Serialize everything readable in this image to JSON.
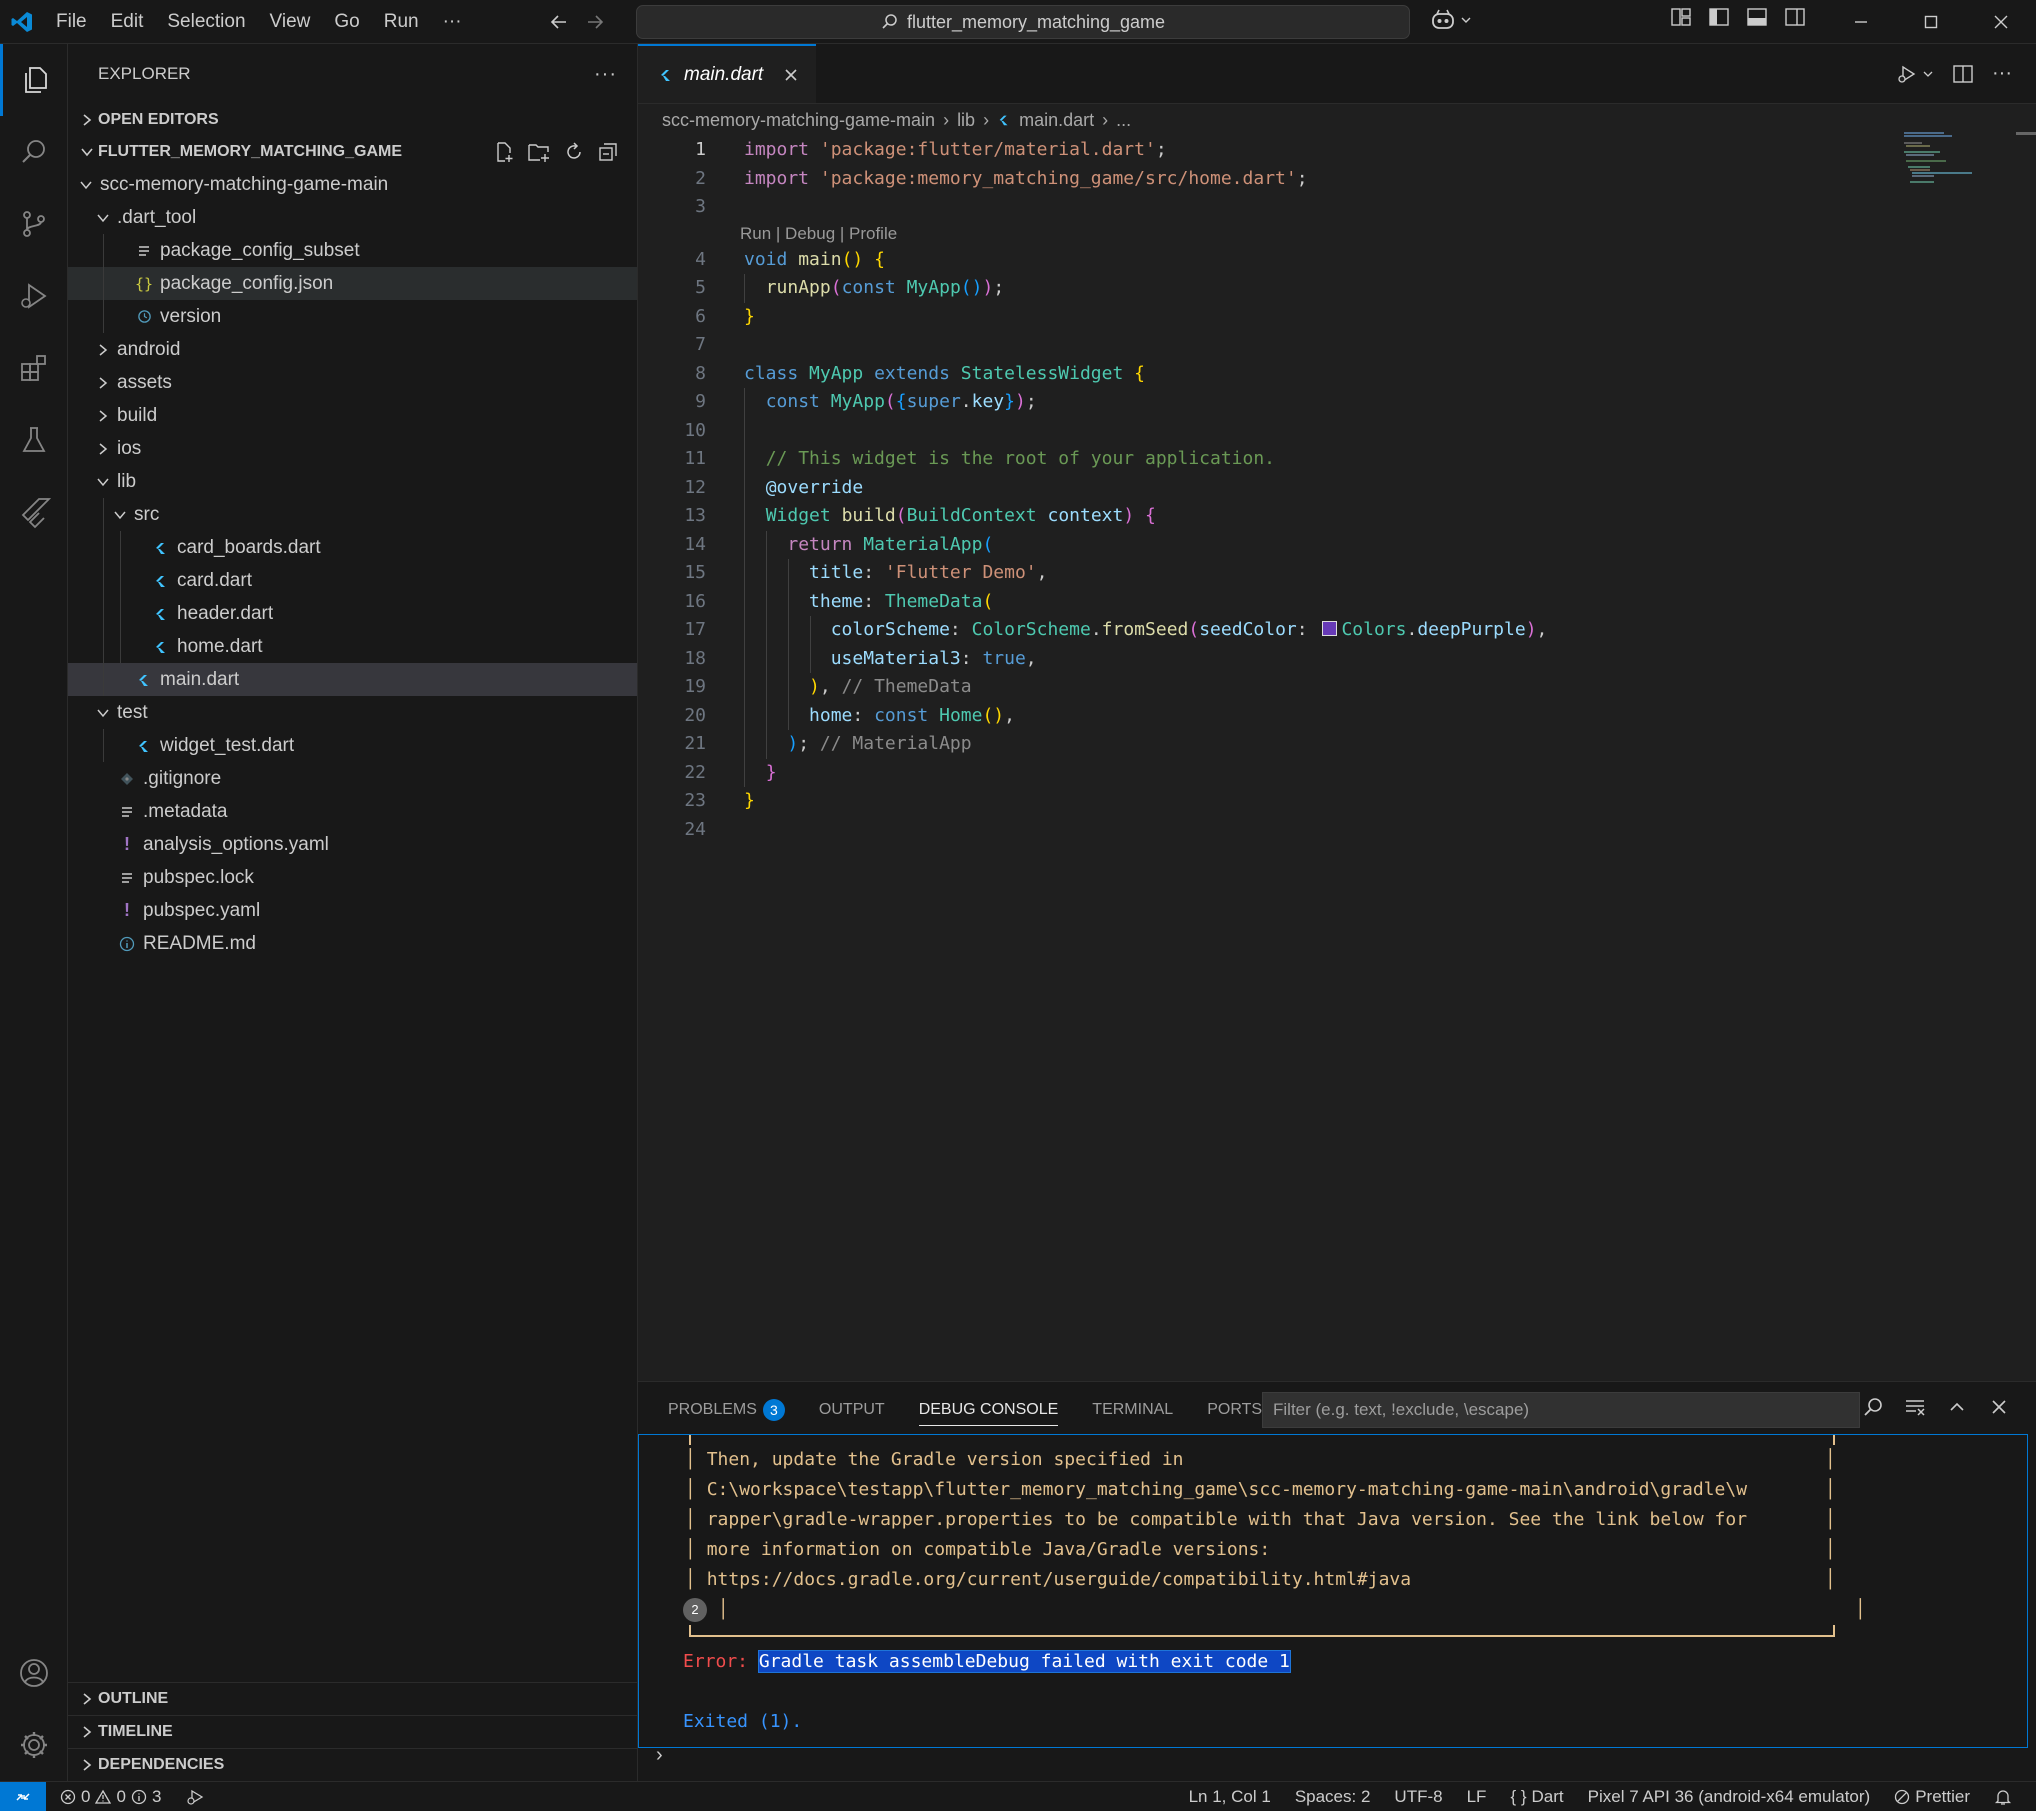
{
  "titlebar": {
    "menu": [
      "File",
      "Edit",
      "Selection",
      "View",
      "Go",
      "Run",
      "···"
    ],
    "search_text": "flutter_memory_matching_game"
  },
  "sidebar": {
    "title": "EXPLORER",
    "open_editors": "OPEN EDITORS",
    "project": "FLUTTER_MEMORY_MATCHING_GAME",
    "tree": [
      {
        "label": "scc-memory-matching-game-main",
        "depth": 0,
        "type": "folder-open"
      },
      {
        "label": ".dart_tool",
        "depth": 1,
        "type": "folder-open"
      },
      {
        "label": "package_config_subset",
        "depth": 2,
        "type": "lines"
      },
      {
        "label": "package_config.json",
        "depth": 2,
        "type": "json"
      },
      {
        "label": "version",
        "depth": 2,
        "type": "clock"
      },
      {
        "label": "android",
        "depth": 1,
        "type": "folder"
      },
      {
        "label": "assets",
        "depth": 1,
        "type": "folder"
      },
      {
        "label": "build",
        "depth": 1,
        "type": "folder"
      },
      {
        "label": "ios",
        "depth": 1,
        "type": "folder"
      },
      {
        "label": "lib",
        "depth": 1,
        "type": "folder-open"
      },
      {
        "label": "src",
        "depth": 2,
        "type": "folder-open"
      },
      {
        "label": "card_boards.dart",
        "depth": 3,
        "type": "dart"
      },
      {
        "label": "card.dart",
        "depth": 3,
        "type": "dart"
      },
      {
        "label": "header.dart",
        "depth": 3,
        "type": "dart"
      },
      {
        "label": "home.dart",
        "depth": 3,
        "type": "dart"
      },
      {
        "label": "main.dart",
        "depth": 2,
        "type": "dart"
      },
      {
        "label": "test",
        "depth": 1,
        "type": "folder-open"
      },
      {
        "label": "widget_test.dart",
        "depth": 2,
        "type": "dart"
      },
      {
        "label": ".gitignore",
        "depth": 1,
        "type": "git"
      },
      {
        "label": ".metadata",
        "depth": 1,
        "type": "lines"
      },
      {
        "label": "analysis_options.yaml",
        "depth": 1,
        "type": "yaml"
      },
      {
        "label": "pubspec.lock",
        "depth": 1,
        "type": "lines"
      },
      {
        "label": "pubspec.yaml",
        "depth": 1,
        "type": "yaml"
      },
      {
        "label": "README.md",
        "depth": 1,
        "type": "info"
      }
    ],
    "bottom_sections": [
      "OUTLINE",
      "TIMELINE",
      "DEPENDENCIES"
    ]
  },
  "editor": {
    "tab_label": "main.dart",
    "breadcrumb": [
      "scc-memory-matching-game-main",
      "lib",
      "main.dart",
      "..."
    ],
    "codelens": "Run | Debug | Profile",
    "line_numbers": [
      "1",
      "2",
      "3",
      "4",
      "5",
      "6",
      "7",
      "8",
      "9",
      "10",
      "11",
      "12",
      "13",
      "14",
      "15",
      "16",
      "17",
      "18",
      "19",
      "20",
      "21",
      "22",
      "23",
      "24"
    ]
  },
  "panel": {
    "tabs": [
      "PROBLEMS",
      "OUTPUT",
      "DEBUG CONSOLE",
      "TERMINAL",
      "PORTS"
    ],
    "problems_count": "3",
    "filter_placeholder": "Filter (e.g. text, !exclude, \\escape)",
    "console_lines": [
      "Then, update the Gradle version specified in",
      "C:\\workspace\\testapp\\flutter_memory_matching_game\\scc-memory-matching-game-main\\android\\gradle\\w",
      "rapper\\gradle-wrapper.properties to be compatible with that Java version. See the link below for",
      "more information on compatible Java/Gradle versions:",
      "https://docs.gradle.org/current/userguide/compatibility.html#java"
    ],
    "repeat_count": "2",
    "error_label": "Error:",
    "error_message": "Gradle task assembleDebug failed with exit code 1",
    "exited": "Exited (1)."
  },
  "statusbar": {
    "errors": "0",
    "warnings": "0",
    "infos": "3",
    "position": "Ln 1, Col 1",
    "spaces": "Spaces: 2",
    "encoding": "UTF-8",
    "eol": "LF",
    "language": "Dart",
    "device": "Pixel 7 API 36 (android-x64 emulator)",
    "formatter": "Prettier"
  },
  "colors": {
    "accent": "#0078d4",
    "background": "#1f1f1f",
    "sidebar": "#181818",
    "error": "#f14c4c",
    "warning_text": "#e2c08d"
  }
}
